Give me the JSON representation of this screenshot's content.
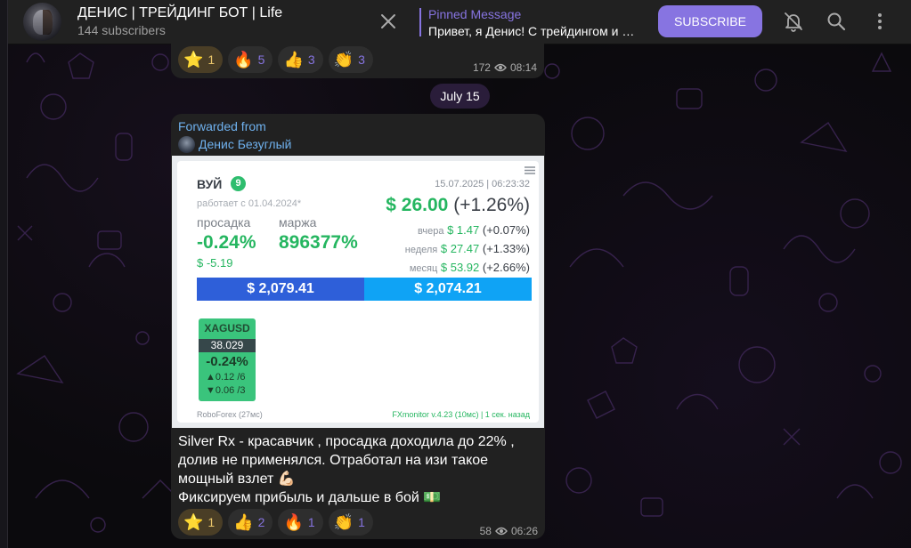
{
  "channel": {
    "title": "ДЕНИС | ТРЕЙДИНГ БОТ | Life",
    "subscribers": "144 subscribers"
  },
  "pinned": {
    "title": "Pinned Message",
    "text": "Привет, я Денис! С трейдингом и …"
  },
  "header": {
    "subscribe_label": "SUBSCRIBE",
    "icons": [
      "mute-bell-icon",
      "search-icon",
      "more-vertical-icon"
    ]
  },
  "prev_message": {
    "reactions": [
      {
        "emoji": "⭐",
        "count": "1",
        "kind": "star"
      },
      {
        "emoji": "🔥",
        "count": "5"
      },
      {
        "emoji": "👍",
        "count": "3"
      },
      {
        "emoji": "👏",
        "count": "3"
      }
    ],
    "views": "172",
    "time": "08:14"
  },
  "date_separator": "July 15",
  "message": {
    "forwarded_label": "Forwarded from",
    "forwarded_name": "Денис Безуглый",
    "screenshot": {
      "name": "ВУЙ",
      "badge": "9",
      "works_since": "работает с 01.04.2024*",
      "drawdown_label": "просадка",
      "margin_label": "маржа",
      "drawdown": "-0.24%",
      "margin": "896377%",
      "drawdown_usd": "$ -5.19",
      "datetime": "15.07.2025 | 06:23:32",
      "profit_value": "$ 26.00",
      "profit_pct": "(+1.26%)",
      "yesterday_label": "вчера",
      "yesterday_value": "$ 1.47",
      "yesterday_pct": "(+0.07%)",
      "week_label": "неделя",
      "week_value": "$ 27.47",
      "week_pct": "(+1.33%)",
      "month_label": "месяц",
      "month_value": "$ 53.92",
      "month_pct": "(+2.66%)",
      "balance": "$ 2,079.41",
      "equity": "$ 2,074.21",
      "ticker": {
        "symbol": "XAGUSD",
        "price": "38.029",
        "change": "-0.24%",
        "up": "▲0.12 /6",
        "down": "▼0.06 /3"
      },
      "footer_left": "RoboForex (27мс)",
      "footer_right": "FXmonitor v.4.23 (10мс) | 1 сек. назад"
    },
    "text_lines": [
      "Silver Rx - красавчик , просадка доходила до 22% ,",
      "долив не применялся. Отработал на изи такое",
      "мощный взлет 💪🏻",
      "Фиксируем прибыль и дальше в бой 💵"
    ],
    "reactions": [
      {
        "emoji": "⭐",
        "count": "1",
        "kind": "star"
      },
      {
        "emoji": "👍",
        "count": "2"
      },
      {
        "emoji": "🔥",
        "count": "1"
      },
      {
        "emoji": "👏",
        "count": "1"
      }
    ],
    "views": "58",
    "time": "06:26"
  },
  "colors": {
    "accent": "#8774e1",
    "link": "#6fb1ee",
    "bubble": "#212121",
    "profit_green": "#25b660"
  }
}
